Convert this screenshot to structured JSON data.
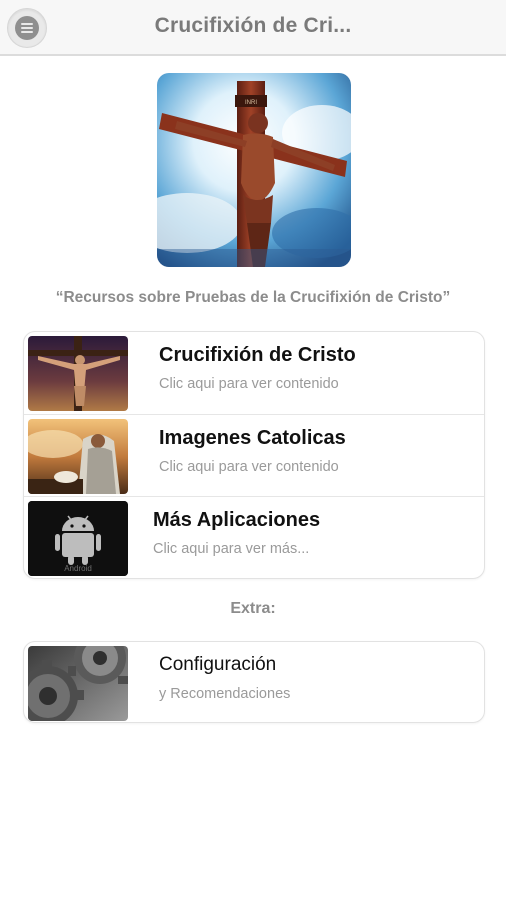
{
  "header": {
    "title": "Crucifixión de Cri..."
  },
  "tagline": "“Recursos sobre Pruebas de la Crucifixión de Cristo”",
  "menu": [
    {
      "title": "Crucifixión de Cristo",
      "subtitle": "Clic aqui para ver contenido"
    },
    {
      "title": "Imagenes Catolicas",
      "subtitle": "Clic aqui para ver contenido"
    },
    {
      "title": "Más Aplicaciones",
      "subtitle": "Clic aqui para ver más..."
    }
  ],
  "extra_label": "Extra:",
  "settings": {
    "title": "Configuración",
    "subtitle": "y Recomendaciones"
  },
  "android_thumb_caption": "Android"
}
